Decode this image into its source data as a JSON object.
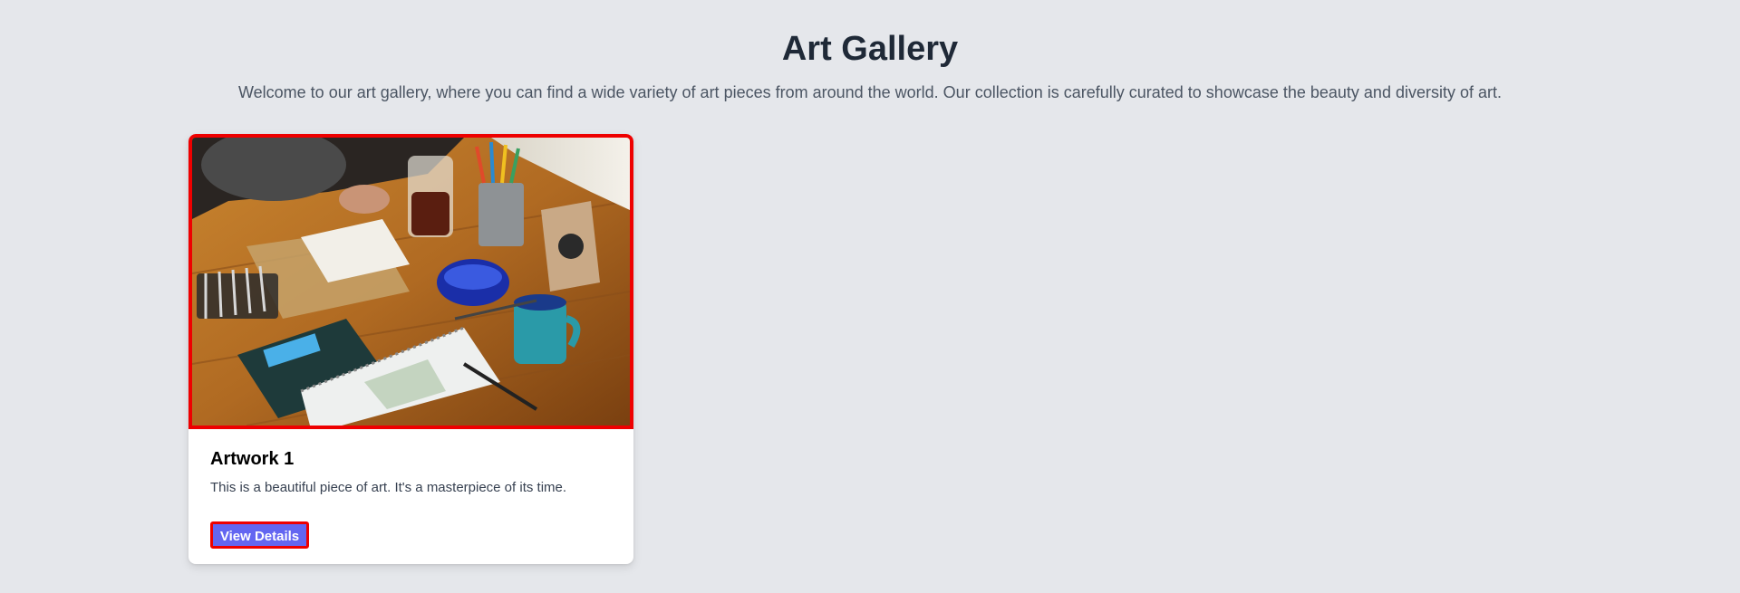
{
  "header": {
    "title": "Art Gallery",
    "intro": "Welcome to our art gallery, where you can find a wide variety of art pieces from around the world. Our collection is carefully curated to showcase the beauty and diversity of art."
  },
  "gallery": {
    "items": [
      {
        "title": "Artwork 1",
        "description": "This is a beautiful piece of art. It's a masterpiece of its time.",
        "button_label": "View Details"
      }
    ]
  },
  "colors": {
    "background": "#e5e7eb",
    "title": "#1f2937",
    "button": "#6366f1",
    "highlight_border": "#ee0000"
  }
}
